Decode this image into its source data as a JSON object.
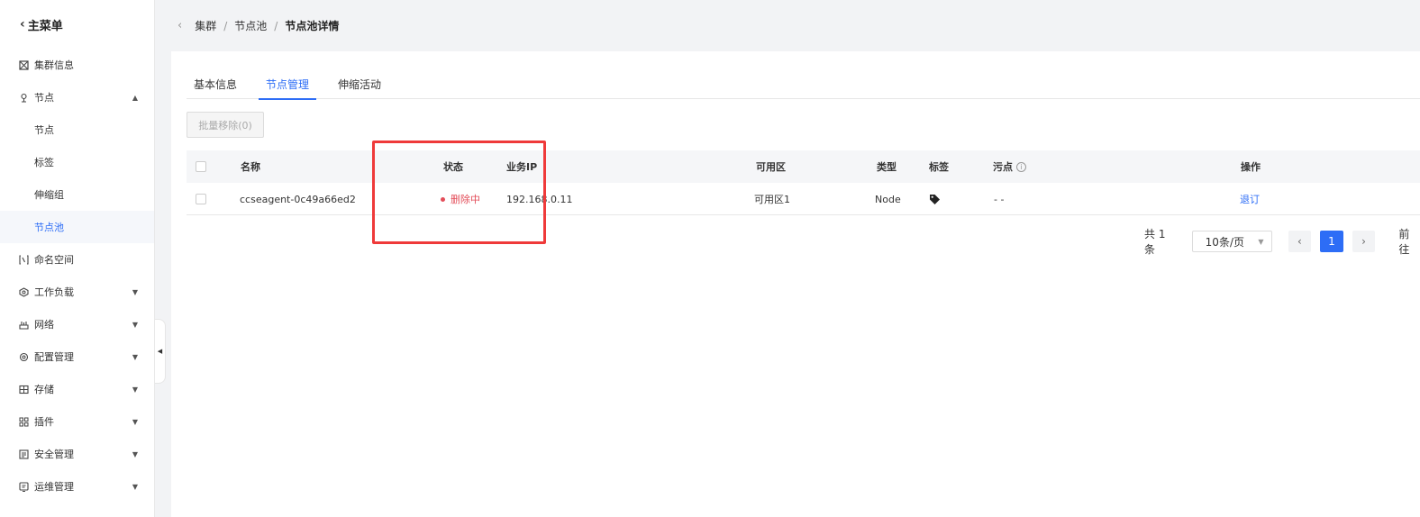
{
  "sidebar": {
    "back_label": "主菜单",
    "items": [
      {
        "label": "集群信息",
        "icon": "cluster-icon",
        "arrow": ""
      },
      {
        "label": "节点",
        "icon": "node-icon",
        "arrow": "▲"
      },
      {
        "label": "命名空间",
        "icon": "namespace-icon",
        "arrow": ""
      },
      {
        "label": "工作负载",
        "icon": "workload-icon",
        "arrow": "▼"
      },
      {
        "label": "网络",
        "icon": "network-icon",
        "arrow": "▼"
      },
      {
        "label": "配置管理",
        "icon": "config-icon",
        "arrow": "▼"
      },
      {
        "label": "存储",
        "icon": "storage-icon",
        "arrow": "▼"
      },
      {
        "label": "插件",
        "icon": "plugin-icon",
        "arrow": "▼"
      },
      {
        "label": "安全管理",
        "icon": "security-icon",
        "arrow": "▼"
      },
      {
        "label": "运维管理",
        "icon": "ops-icon",
        "arrow": "▼"
      }
    ],
    "node_sub_items": [
      "节点",
      "标签",
      "伸缩组",
      "节点池"
    ]
  },
  "breadcrumb": {
    "items": [
      "集群",
      "节点池",
      "节点池详情"
    ],
    "separator": "/"
  },
  "tabs": [
    "基本信息",
    "节点管理",
    "伸缩活动"
  ],
  "active_tab": "节点管理",
  "batch_remove_label": "批量移除(0)",
  "table": {
    "headers": {
      "name": "名称",
      "status": "状态",
      "ip": "业务IP",
      "zone": "可用区",
      "type": "类型",
      "labels": "标签",
      "taints": "污点",
      "actions": "操作"
    },
    "rows": [
      {
        "name": "ccseagent-0c49a66ed2",
        "status": "删除中",
        "ip": "192.168.0.11",
        "zone": "可用区1",
        "type": "Node",
        "taints": "- -",
        "action": "退订"
      }
    ]
  },
  "pagination": {
    "total": "共 1 条",
    "page_size": "10条/页",
    "current_page": "1",
    "goto": "前往"
  },
  "colors": {
    "accent": "#2d6df6",
    "status_deleting": "#e34d59",
    "highlight": "#ef3a3a"
  }
}
